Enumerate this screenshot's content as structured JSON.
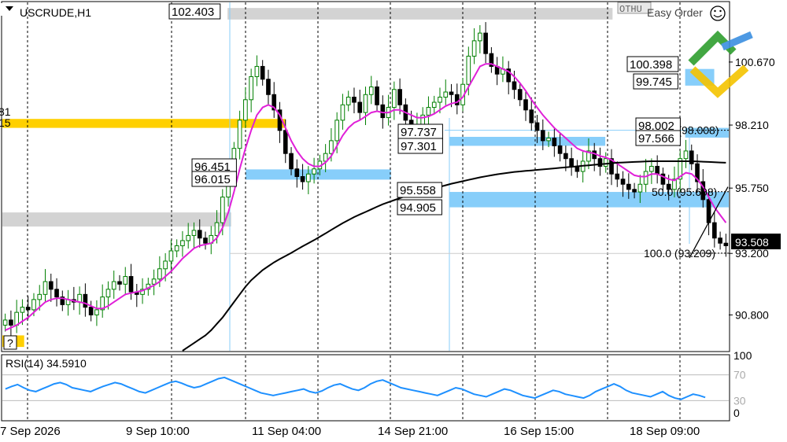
{
  "header": {
    "symbol": "USCRUDE,H1",
    "one_click": "Easy Order",
    "question": "?"
  },
  "chart_data": {
    "type": "candlestick",
    "symbol": "USCRUDE,H1",
    "ylim": [
      89.4,
      103.0
    ],
    "y_ticks": [
      90.8,
      93.2,
      95.75,
      98.21,
      100.67
    ],
    "current_price": 93.508,
    "x_tick_labels": [
      "7 Sep 2026",
      "9 Sep 10:00",
      "11 Sep 04:00",
      "14 Sep 21:00",
      "16 Sep 15:00",
      "18 Sep 09:00"
    ],
    "price_series": [
      90.6,
      90.4,
      90.9,
      91.1,
      91.0,
      91.4,
      91.6,
      92.1,
      91.8,
      91.5,
      91.2,
      91.4,
      91.3,
      91.6,
      91.1,
      90.8,
      91.0,
      91.5,
      91.8,
      92.1,
      92.0,
      92.3,
      91.7,
      91.6,
      91.8,
      92.0,
      92.2,
      92.6,
      92.9,
      93.3,
      93.5,
      93.7,
      93.9,
      94.1,
      93.8,
      93.6,
      93.9,
      94.4,
      95.4,
      96.3,
      97.3,
      98.4,
      99.2,
      100.1,
      100.5,
      100.0,
      99.4,
      98.8,
      98.0,
      97.1,
      96.5,
      96.2,
      96.0,
      96.3,
      96.5,
      96.8,
      97.1,
      97.6,
      98.4,
      99.0,
      99.3,
      99.1,
      98.7,
      99.4,
      99.7,
      99.0,
      98.5,
      98.9,
      99.6,
      99.0,
      98.4,
      97.9,
      98.2,
      98.6,
      98.9,
      99.1,
      99.3,
      99.5,
      99.4,
      99.0,
      99.8,
      100.9,
      101.5,
      101.8,
      101.0,
      100.5,
      100.2,
      100.4,
      99.9,
      99.6,
      99.2,
      98.8,
      98.3,
      98.0,
      97.6,
      97.7,
      97.4,
      97.1,
      96.9,
      96.6,
      96.4,
      96.8,
      97.2,
      96.9,
      96.6,
      96.9,
      96.3,
      96.1,
      95.9,
      95.7,
      95.6,
      95.9,
      96.4,
      96.6,
      96.3,
      95.9,
      95.7,
      96.1,
      96.9,
      97.2,
      96.7,
      96.0,
      95.3,
      94.4,
      93.8,
      93.6,
      93.5
    ],
    "series": [
      {
        "name": "",
        "color": "#e020d8",
        "values": [
          90.2,
          90.3,
          90.4,
          90.55,
          90.7,
          90.9,
          91.1,
          91.3,
          91.4,
          91.45,
          91.45,
          91.4,
          91.35,
          91.3,
          91.25,
          91.15,
          91.05,
          91.05,
          91.15,
          91.3,
          91.45,
          91.6,
          91.65,
          91.7,
          91.75,
          91.85,
          91.95,
          92.1,
          92.3,
          92.5,
          92.75,
          93.0,
          93.2,
          93.4,
          93.5,
          93.55,
          93.6,
          93.8,
          94.2,
          94.8,
          95.6,
          96.5,
          97.3,
          98.0,
          98.6,
          98.9,
          99.0,
          98.9,
          98.6,
          98.1,
          97.6,
          97.2,
          96.9,
          96.7,
          96.6,
          96.6,
          96.75,
          97.0,
          97.4,
          97.8,
          98.1,
          98.3,
          98.4,
          98.55,
          98.7,
          98.75,
          98.7,
          98.7,
          98.8,
          98.8,
          98.7,
          98.6,
          98.5,
          98.5,
          98.55,
          98.65,
          98.8,
          98.95,
          99.05,
          99.1,
          99.3,
          99.7,
          100.1,
          100.5,
          100.6,
          100.6,
          100.5,
          100.4,
          100.3,
          100.1,
          99.85,
          99.55,
          99.2,
          98.9,
          98.6,
          98.35,
          98.1,
          97.9,
          97.7,
          97.5,
          97.3,
          97.2,
          97.15,
          97.1,
          97.0,
          96.95,
          96.85,
          96.7,
          96.55,
          96.4,
          96.25,
          96.2,
          96.2,
          96.3,
          96.3,
          96.2,
          96.1,
          96.05,
          96.2,
          96.35,
          96.3,
          96.1,
          95.8,
          95.4,
          95.0,
          94.7,
          94.4
        ]
      },
      {
        "name": "",
        "color": "#000000",
        "values": [
          null,
          null,
          null,
          null,
          null,
          null,
          null,
          null,
          null,
          null,
          null,
          null,
          null,
          null,
          null,
          null,
          null,
          null,
          null,
          null,
          null,
          null,
          null,
          null,
          null,
          null,
          null,
          null,
          null,
          null,
          null,
          89.4,
          89.55,
          89.7,
          89.85,
          90.0,
          90.2,
          90.45,
          90.7,
          91.0,
          91.3,
          91.6,
          91.9,
          92.15,
          92.35,
          92.55,
          92.7,
          92.85,
          92.98,
          93.1,
          93.22,
          93.35,
          93.48,
          93.6,
          93.72,
          93.85,
          93.98,
          94.12,
          94.25,
          94.38,
          94.5,
          94.62,
          94.72,
          94.82,
          94.92,
          95.02,
          95.12,
          95.2,
          95.28,
          95.36,
          95.44,
          95.5,
          95.56,
          95.62,
          95.68,
          95.74,
          95.8,
          95.86,
          95.92,
          95.97,
          96.02,
          96.07,
          96.12,
          96.17,
          96.21,
          96.25,
          96.29,
          96.32,
          96.35,
          96.38,
          96.4,
          96.42,
          96.44,
          96.46,
          96.48,
          96.5,
          96.52,
          96.54,
          96.56,
          96.58,
          96.6,
          96.62,
          96.64,
          96.66,
          96.68,
          96.7,
          96.72,
          96.74,
          96.75,
          96.76,
          96.77,
          96.78,
          96.79,
          96.8,
          96.8,
          96.8,
          96.8,
          96.8,
          96.8,
          96.8,
          96.8,
          96.79,
          96.78,
          96.77,
          96.76,
          96.75,
          96.74
        ]
      }
    ],
    "price_boxes": [
      {
        "text": "102.403",
        "price": 102.403
      },
      {
        "text": "100.398",
        "price": 100.398
      },
      {
        "text": "99.745",
        "price": 99.745
      },
      {
        "text": "97.737",
        "price": 97.737
      },
      {
        "text": "97.301",
        "price": 97.301
      },
      {
        "text": "96.451",
        "price": 96.451
      },
      {
        "text": "96.015",
        "price": 96.015
      },
      {
        "text": "95.558",
        "price": 95.558
      },
      {
        "text": "94.905",
        "price": 94.905
      },
      {
        "text": "98.002",
        "price": 98.002
      },
      {
        "text": "97.566",
        "price": 97.566
      }
    ],
    "zones": [
      {
        "color": "#FFD000",
        "top": 98.45,
        "bottom": 98.1,
        "start": 0.0,
        "end": 0.39
      },
      {
        "color": "#D3D3D3",
        "top": 94.8,
        "bottom": 94.25,
        "start": 0.0,
        "end": 0.315
      },
      {
        "color": "#87CEFA",
        "top": 96.48,
        "bottom": 96.08,
        "start": 0.335,
        "end": 0.535
      },
      {
        "color": "#87CEFA",
        "top": 97.75,
        "bottom": 97.4,
        "start": 0.615,
        "end": 0.83
      },
      {
        "color": "#87CEFA",
        "top": 95.6,
        "bottom": 95.0,
        "start": 0.615,
        "end": 1.0
      },
      {
        "color": "#87CEFA",
        "top": 98.1,
        "bottom": 97.72,
        "start": 0.94,
        "end": 1.0
      },
      {
        "color": "#87CEFA",
        "top": 100.4,
        "bottom": 99.75,
        "start": 0.94,
        "end": 0.98
      },
      {
        "color": "#D3D3D3",
        "top": 102.78,
        "bottom": 102.33,
        "start": 0.31,
        "end": 0.84
      },
      {
        "color": "#FFD000",
        "top": 90.0,
        "bottom": 89.55,
        "start": 0.0,
        "end": 0.03
      }
    ],
    "fibonacci": [
      {
        "label": "0.0 (98.008)",
        "price": 98.008
      },
      {
        "label": "50.0 (95.608)",
        "price": 95.608
      },
      {
        "label": "100.0 (93.209)",
        "price": 93.209
      }
    ],
    "left_clipped_labels": [
      "81",
      "15"
    ]
  },
  "rsi": {
    "label": "RSI(14) 34.5910",
    "ylim": [
      0,
      100
    ],
    "levels": [
      30,
      70
    ],
    "axis_labels": [
      "100",
      "70",
      "30",
      "0"
    ],
    "color": "#1E90FF",
    "values": [
      48,
      52,
      55,
      50,
      46,
      44,
      48,
      52,
      56,
      58,
      55,
      50,
      48,
      46,
      44,
      48,
      52,
      55,
      58,
      56,
      52,
      48,
      44,
      42,
      46,
      50,
      54,
      58,
      60,
      57,
      53,
      50,
      52,
      56,
      60,
      64,
      66,
      62,
      58,
      54,
      50,
      46,
      42,
      40,
      38,
      40,
      42,
      44,
      46,
      48,
      44,
      42,
      45,
      50,
      54,
      56,
      52,
      48,
      46,
      50,
      56,
      60,
      62,
      58,
      54,
      50,
      48,
      46,
      44,
      42,
      40,
      38,
      42,
      46,
      50,
      48,
      44,
      40,
      38,
      36,
      40,
      44,
      48,
      46,
      42,
      38,
      36,
      34,
      38,
      42,
      46,
      44,
      40,
      38,
      36,
      34,
      38,
      44,
      48,
      52,
      56,
      52,
      46,
      42,
      40,
      38,
      36,
      40,
      44,
      38,
      34,
      32,
      36,
      40,
      38,
      35
    ]
  },
  "colors": {
    "up": "#007F00",
    "down": "#000000",
    "grid": "#000000"
  }
}
